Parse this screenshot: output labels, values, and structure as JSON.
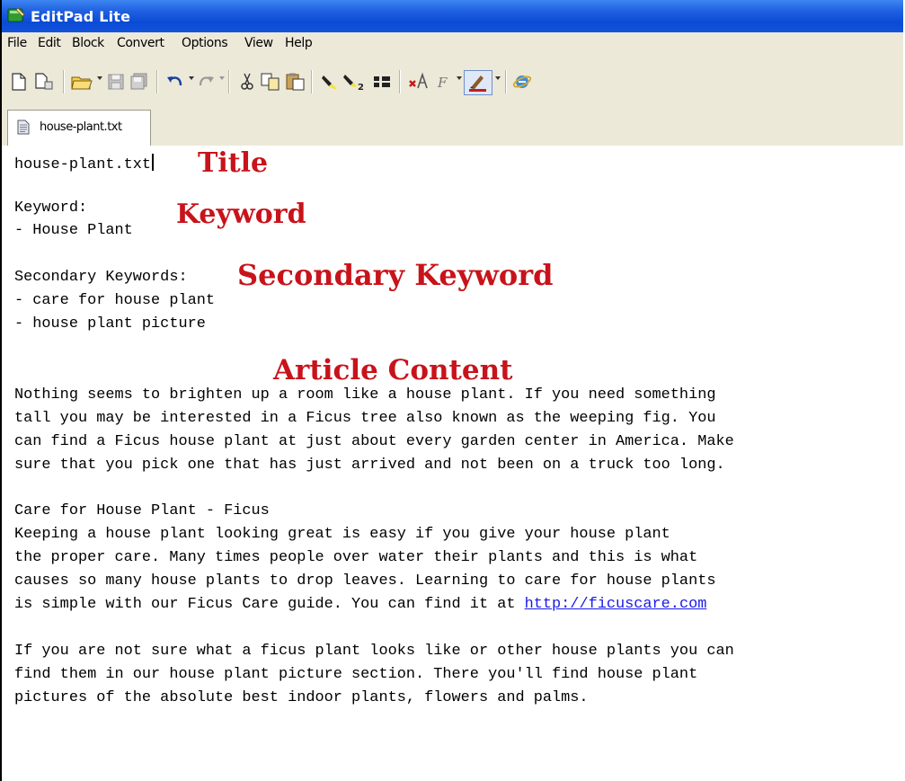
{
  "window": {
    "title": "EditPad Lite"
  },
  "menu": {
    "items": [
      "File",
      "Edit",
      "Block",
      "Convert",
      "Options",
      "View",
      "Help"
    ]
  },
  "toolbar": {
    "icons": [
      "new-file-icon",
      "open-file-icon",
      "open-folder-icon",
      "save-icon",
      "save-all-icon",
      "undo-icon",
      "redo-icon",
      "cut-icon",
      "copy-icon",
      "paste-icon",
      "highlighter-icon",
      "find-replace-icon",
      "find-next-icon",
      "clear-format-icon",
      "font-icon",
      "color-icon",
      "web-browser-icon"
    ]
  },
  "tabs": [
    {
      "label": "house-plant.txt",
      "active": true
    }
  ],
  "document": {
    "lines": [
      "house-plant.txt",
      "",
      "Keyword:",
      "- House Plant",
      "",
      "Secondary Keywords:",
      "- care for house plant",
      "- house plant picture",
      "",
      "",
      "Nothing seems to brighten up a room like a house plant. If you need something",
      "tall you may be interested in a Ficus tree also known as the weeping fig. You",
      "can find a Ficus house plant at just about every garden center in America. Make",
      "sure that you pick one that has just arrived and not been on a truck too long.",
      "",
      "Care for House Plant - Ficus",
      "Keeping a house plant looking great is easy if you give your house plant",
      "the proper care. Many times people over water their plants and this is what",
      "causes so many house plants to drop leaves. Learning to care for house plants",
      "",
      "",
      "If you are not sure what a ficus plant looks like or other house plants you can",
      "find them in our house plant picture section. There you'll find house plant",
      "pictures of the absolute best indoor plants, flowers and palms."
    ],
    "link_line_prefix": "is simple with our Ficus Care guide. You can find it at ",
    "link_text": "http://ficuscare.com"
  },
  "annotations": {
    "title": "Title",
    "keyword": "Keyword",
    "secondary_keyword": "Secondary Keyword",
    "article_content": "Article Content"
  },
  "colors": {
    "annotation": "#c8131b",
    "link": "#1a1ae6",
    "titlebar": "#0a4bd6"
  }
}
